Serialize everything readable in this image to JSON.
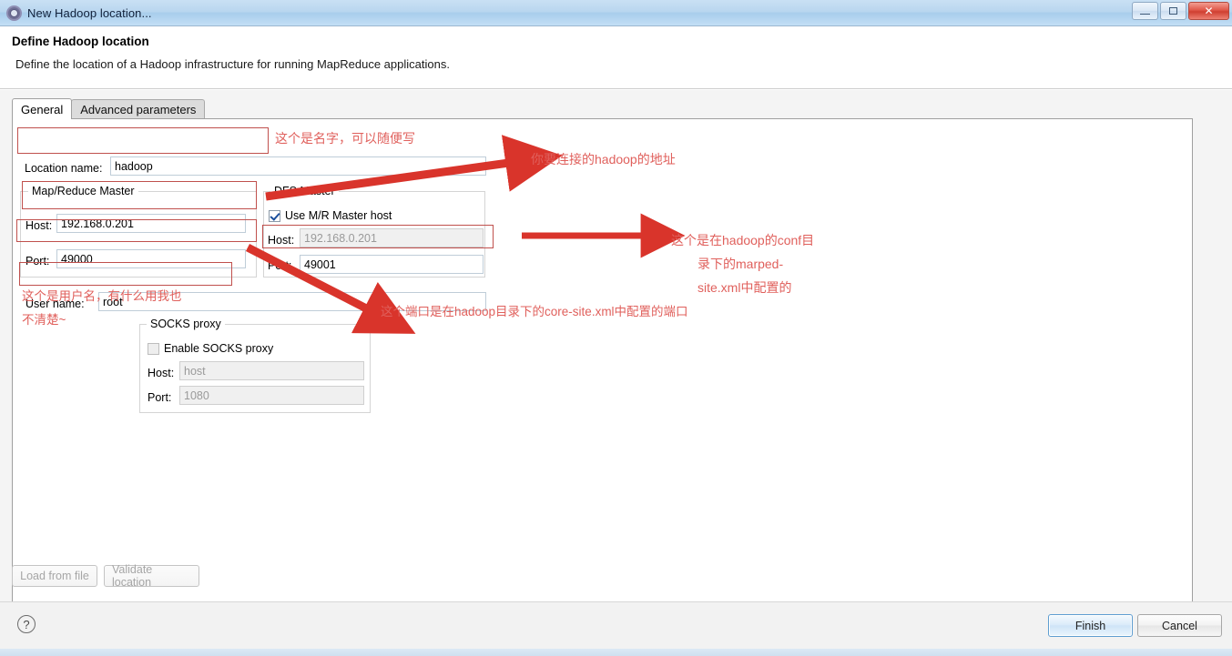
{
  "window": {
    "title": "New Hadoop location...",
    "icon": "hadoop-elephant-icon",
    "controls": {
      "minimize": "minimize-icon",
      "maximize": "maximize-icon",
      "close": "✕"
    }
  },
  "banner": {
    "title": "Define Hadoop location",
    "subtitle": "Define the location of a Hadoop infrastructure for running MapReduce applications."
  },
  "tabs": [
    {
      "label": "General",
      "active": true
    },
    {
      "label": "Advanced parameters",
      "active": false
    }
  ],
  "form": {
    "location_name": {
      "label": "Location name:",
      "value": "hadoop"
    },
    "mapreduce_master": {
      "legend": "Map/Reduce Master",
      "host_label": "Host:",
      "host_value": "192.168.0.201",
      "port_label": "Port:",
      "port_value": "49000"
    },
    "dfs_master": {
      "legend": "DFS Master",
      "use_mr_master_host_label": "Use M/R Master host",
      "use_mr_master_host_checked": true,
      "host_label": "Host:",
      "host_value": "192.168.0.201",
      "host_disabled": true,
      "port_label": "Port:",
      "port_value": "49001"
    },
    "user_name": {
      "label": "User name:",
      "value": "root"
    },
    "socks_proxy": {
      "legend": "SOCKS proxy",
      "enable_label": "Enable SOCKS proxy",
      "enable_checked": false,
      "host_label": "Host:",
      "host_value": "host",
      "port_label": "Port:",
      "port_value": "1080"
    }
  },
  "buttons": {
    "load_from_file": "Load from file",
    "validate_location": "Validate location",
    "finish": "Finish",
    "cancel": "Cancel",
    "help": "?"
  },
  "annotations": {
    "location_name_note": "这个是名字，可以随便写",
    "hadoop_address_note": "你要连接的hadoop的地址",
    "conf_dir_note_line1": "这个是在hadoop的conf目",
    "conf_dir_note_line2": "录下的marped-",
    "conf_dir_note_line3": "site.xml中配置的",
    "core_site_note": "这个端口是在hadoop目录下的core-site.xml中配置的端口",
    "user_name_note_line1": "这个是用户名，有什么用我也",
    "user_name_note_line2": "不清楚~"
  },
  "colors": {
    "annotation_red": "#e0605c",
    "annotation_box_red": "#c0504d",
    "arrow_red": "#d9342b",
    "titlebar_blue": "#b9d6ef",
    "close_red": "#cf3f31"
  }
}
